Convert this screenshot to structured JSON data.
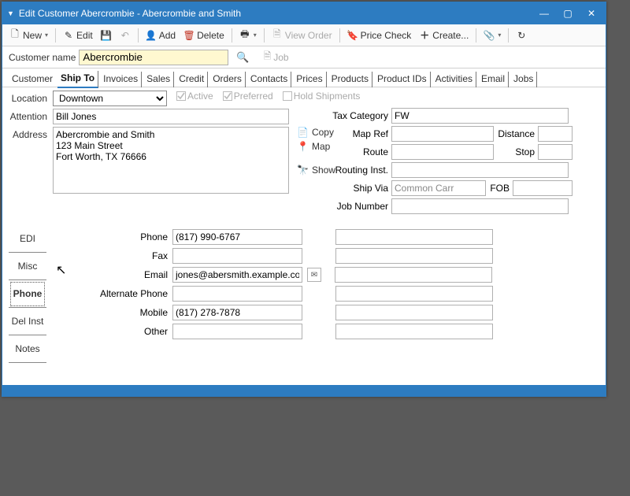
{
  "window": {
    "title": "Edit Customer Abercrombie - Abercrombie and Smith"
  },
  "toolbar": {
    "new": "New",
    "edit": "Edit",
    "add": "Add",
    "delete": "Delete",
    "viewOrder": "View Order",
    "priceCheck": "Price Check",
    "create": "Create..."
  },
  "namebar": {
    "label": "Customer name",
    "value": "Abercrombie",
    "jobLabel": "Job"
  },
  "tabs": [
    "Customer",
    "Ship To",
    "Invoices",
    "Sales",
    "Credit",
    "Orders",
    "Contacts",
    "Prices",
    "Products",
    "Product IDs",
    "Activities",
    "Email",
    "Jobs"
  ],
  "top": {
    "locationLabel": "Location",
    "location": "Downtown",
    "active": "Active",
    "preferred": "Preferred",
    "holdShipments": "Hold Shipments",
    "attentionLabel": "Attention",
    "attention": "Bill Jones",
    "addressLabel": "Address",
    "address": "Abercrombie and Smith\n123 Main Street\nFort Worth, TX 76666",
    "copy": "Copy",
    "map": "Map",
    "show": "Show"
  },
  "right": {
    "taxCatLabel": "Tax Category",
    "taxCat": "FW",
    "mapRefLabel": "Map Ref",
    "mapRef": "",
    "distanceLabel": "Distance",
    "distance": "",
    "routeLabel": "Route",
    "route": "",
    "stopLabel": "Stop",
    "stop": "",
    "routingLabel": "Routing Inst.",
    "routing": "",
    "shipViaLabel": "Ship Via",
    "shipVia": "Common Carr",
    "fobLabel": "FOB",
    "fob": "",
    "jobNumLabel": "Job Number",
    "jobNum": ""
  },
  "phoneTabs": [
    "EDI",
    "Misc",
    "Phone",
    "Del Inst",
    "Notes"
  ],
  "phone": {
    "phoneLabel": "Phone",
    "phone": "(817) 990-6767",
    "faxLabel": "Fax",
    "fax": "",
    "emailLabel": "Email",
    "email": "jones@abersmith.example.com",
    "altLabel": "Alternate Phone",
    "alt": "",
    "mobileLabel": "Mobile",
    "mobile": "(817) 278-7878",
    "otherLabel": "Other",
    "other": ""
  }
}
